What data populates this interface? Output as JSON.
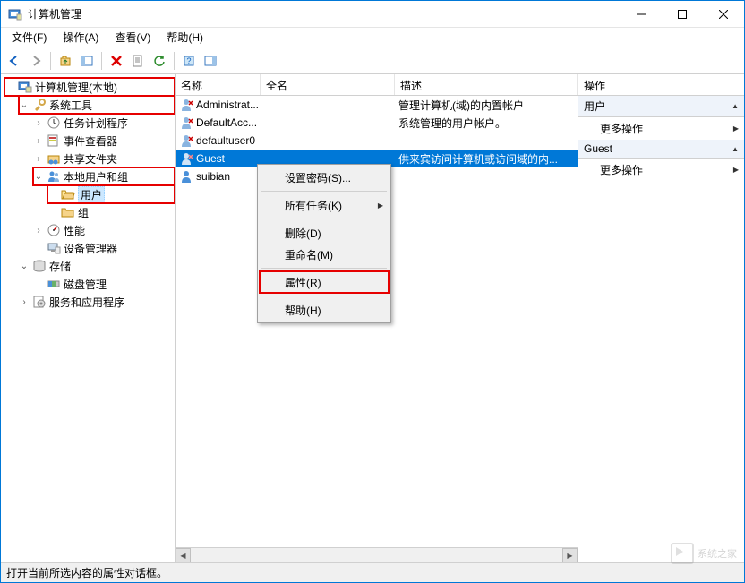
{
  "window": {
    "title": "计算机管理"
  },
  "menubar": {
    "file": "文件(F)",
    "action": "操作(A)",
    "view": "查看(V)",
    "help": "帮助(H)"
  },
  "tree": {
    "root": "计算机管理(本地)",
    "system_tools": "系统工具",
    "task_scheduler": "任务计划程序",
    "event_viewer": "事件查看器",
    "shared_folders": "共享文件夹",
    "local_users_groups": "本地用户和组",
    "users": "用户",
    "groups": "组",
    "performance": "性能",
    "device_manager": "设备管理器",
    "storage": "存储",
    "disk_management": "磁盘管理",
    "services_apps": "服务和应用程序"
  },
  "list": {
    "columns": {
      "name": "名称",
      "fullname": "全名",
      "description": "描述"
    },
    "rows": [
      {
        "name": "Administrat...",
        "fullname": "",
        "description": "管理计算机(域)的内置帐户"
      },
      {
        "name": "DefaultAcc...",
        "fullname": "",
        "description": "系统管理的用户帐户。"
      },
      {
        "name": "defaultuser0",
        "fullname": "",
        "description": ""
      },
      {
        "name": "Guest",
        "fullname": "",
        "description": "供来宾访问计算机或访问域的内..."
      },
      {
        "name": "suibian",
        "fullname": "",
        "description": ""
      }
    ]
  },
  "context_menu": {
    "set_password": "设置密码(S)...",
    "all_tasks": "所有任务(K)",
    "delete": "删除(D)",
    "rename": "重命名(M)",
    "properties": "属性(R)",
    "help": "帮助(H)"
  },
  "actions": {
    "title": "操作",
    "section1": "用户",
    "more1": "更多操作",
    "section2": "Guest",
    "more2": "更多操作"
  },
  "statusbar": {
    "text": "打开当前所选内容的属性对话框。"
  },
  "watermark": {
    "line1": "系统之家"
  }
}
